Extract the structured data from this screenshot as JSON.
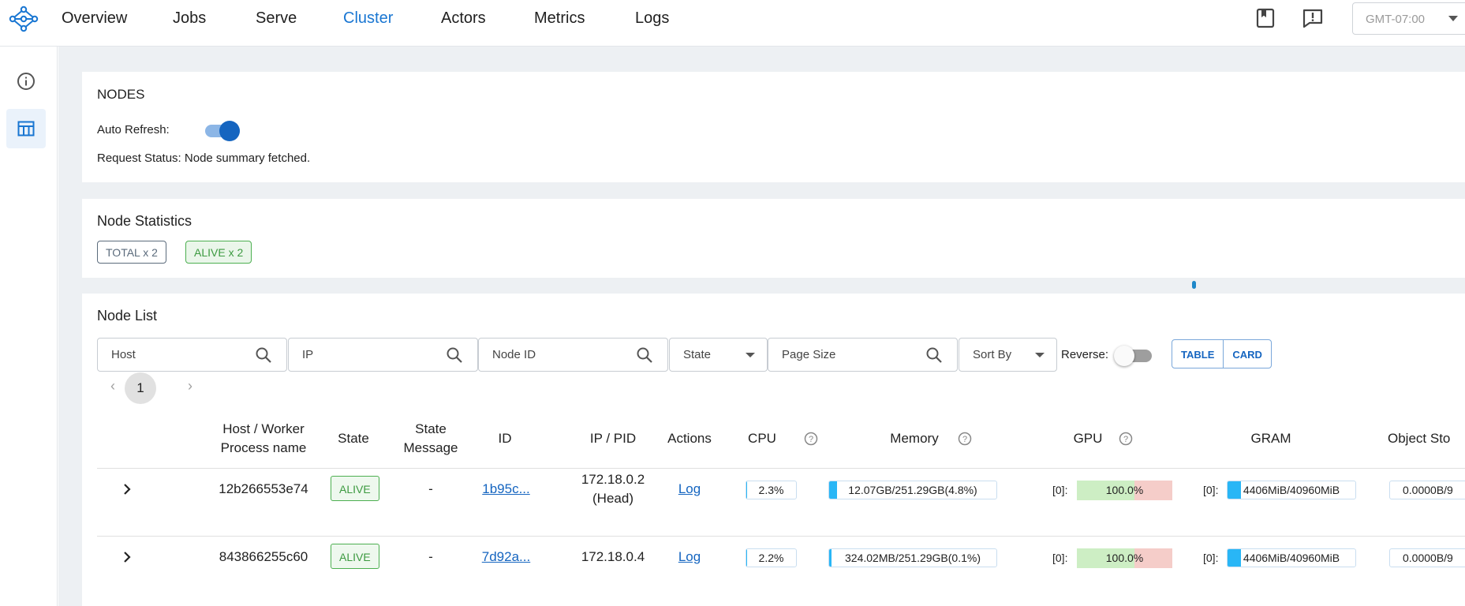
{
  "nav": {
    "items": [
      {
        "label": "Overview",
        "active": false
      },
      {
        "label": "Jobs",
        "active": false
      },
      {
        "label": "Serve",
        "active": false
      },
      {
        "label": "Cluster",
        "active": true
      },
      {
        "label": "Actors",
        "active": false
      },
      {
        "label": "Metrics",
        "active": false
      },
      {
        "label": "Logs",
        "active": false
      }
    ],
    "timezone": "GMT-07:00",
    "accent_color": "#1976d2"
  },
  "sidebar": {
    "items": [
      {
        "icon": "info-icon",
        "active": false
      },
      {
        "icon": "table-icon",
        "active": true
      }
    ]
  },
  "nodes_card": {
    "title": "NODES",
    "auto_refresh_label": "Auto Refresh:",
    "auto_refresh_on": true,
    "request_status": "Request Status: Node summary fetched."
  },
  "stats_card": {
    "title": "Node Statistics",
    "total_chip": "TOTAL x 2",
    "alive_chip": "ALIVE x 2"
  },
  "node_list": {
    "title": "Node List",
    "filters": {
      "host": "Host",
      "ip": "IP",
      "node_id": "Node ID",
      "state": "State",
      "page_size": "Page Size",
      "sort_by": "Sort By",
      "reverse_label": "Reverse:",
      "reverse_on": false
    },
    "view_toggle": {
      "table": "TABLE",
      "card": "CARD"
    },
    "pagination": {
      "prev": "‹",
      "current": "1",
      "next": "›"
    },
    "columns": {
      "host_line1": "Host / Worker",
      "host_line2": "Process name",
      "state": "State",
      "state_msg_line1": "State",
      "state_msg_line2": "Message",
      "id": "ID",
      "ip_pid": "IP / PID",
      "actions": "Actions",
      "cpu": "CPU",
      "memory": "Memory",
      "gpu": "GPU",
      "gram": "GRAM",
      "object_store": "Object Sto"
    },
    "rows": [
      {
        "host": "12b266553e74",
        "state": "ALIVE",
        "state_message": "-",
        "id": "1b95c...",
        "ip_line1": "172.18.0.2",
        "ip_line2": "(Head)",
        "action": "Log",
        "cpu": "2.3%",
        "cpu_pct": 2.3,
        "memory": "12.07GB/251.29GB(4.8%)",
        "memory_pct": 4.8,
        "gpu_index": "[0]:",
        "gpu": "100.0%",
        "gpu_pct": 100,
        "gram_index": "[0]:",
        "gram": "4406MiB/40960MiB",
        "gram_pct": 10.8,
        "object_store": "0.0000B/9"
      },
      {
        "host": "843866255c60",
        "state": "ALIVE",
        "state_message": "-",
        "id": "7d92a...",
        "ip_line1": "172.18.0.4",
        "ip_line2": "",
        "action": "Log",
        "cpu": "2.2%",
        "cpu_pct": 2.2,
        "memory": "324.02MB/251.29GB(0.1%)",
        "memory_pct": 0.1,
        "gpu_index": "[0]:",
        "gpu": "100.0%",
        "gpu_pct": 100,
        "gram_index": "[0]:",
        "gram": "4406MiB/40960MiB",
        "gram_pct": 10.8,
        "object_store": "0.0000B/9"
      }
    ]
  }
}
